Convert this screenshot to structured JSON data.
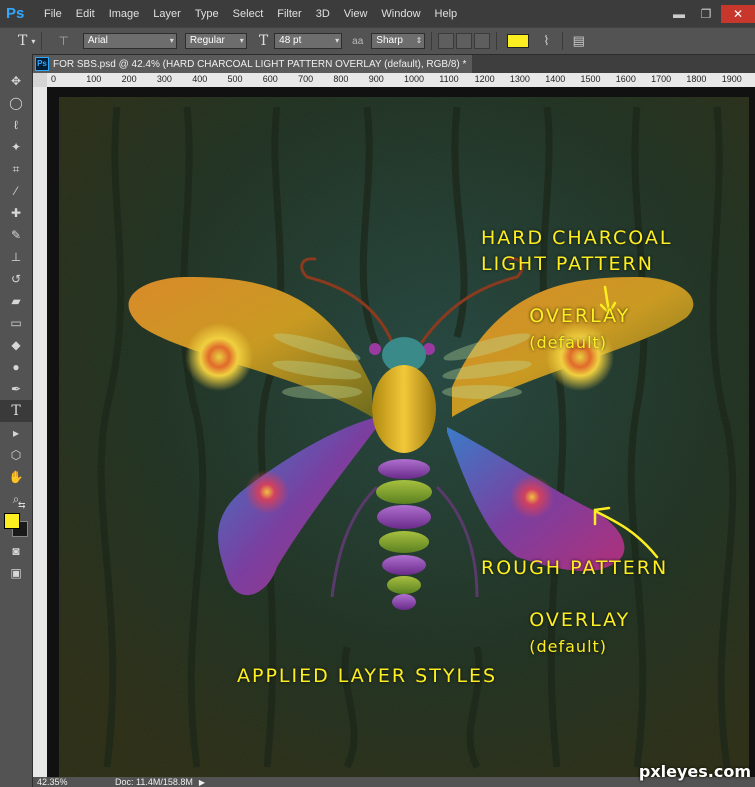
{
  "app": {
    "logo": "Ps"
  },
  "menu": [
    "File",
    "Edit",
    "Image",
    "Layer",
    "Type",
    "Select",
    "Filter",
    "3D",
    "View",
    "Window",
    "Help"
  ],
  "window_controls": {
    "minimize": "▬",
    "restore": "❐",
    "close": "✕"
  },
  "options": {
    "tool_icon": "T",
    "orientation_icon": "⊤",
    "font_family": "Arial",
    "font_style": "Regular",
    "size_icon": "T",
    "font_size": "48 pt",
    "aa_icon": "aa",
    "antialias": "Sharp",
    "warp_icon": "⌇",
    "panels_icon": "▤",
    "text_color": "#fcee21"
  },
  "document": {
    "tab_icon": "Ps",
    "tab_title": "FOR SBS.psd @ 42.4% (HARD CHARCOAL LIGHT PATTERN OVERLAY (default), RGB/8) *",
    "ruler_ticks": [
      "0",
      "100",
      "200",
      "300",
      "400",
      "500",
      "600",
      "700",
      "800",
      "900",
      "1000",
      "1100",
      "1200",
      "1300",
      "1400",
      "1500",
      "1600",
      "1700",
      "1800",
      "1900"
    ]
  },
  "tools": [
    {
      "name": "move",
      "glyph": "✥"
    },
    {
      "name": "marquee",
      "glyph": "◯"
    },
    {
      "name": "lasso",
      "glyph": "ℓ"
    },
    {
      "name": "quick-select",
      "glyph": "✦"
    },
    {
      "name": "crop",
      "glyph": "⌗"
    },
    {
      "name": "eyedropper",
      "glyph": "⁄"
    },
    {
      "name": "healing",
      "glyph": "✚"
    },
    {
      "name": "brush",
      "glyph": "✎"
    },
    {
      "name": "stamp",
      "glyph": "⊥"
    },
    {
      "name": "history-brush",
      "glyph": "↺"
    },
    {
      "name": "eraser",
      "glyph": "▰"
    },
    {
      "name": "gradient",
      "glyph": "▭"
    },
    {
      "name": "blur",
      "glyph": "◆"
    },
    {
      "name": "dodge",
      "glyph": "●"
    },
    {
      "name": "pen",
      "glyph": "✒"
    },
    {
      "name": "type",
      "glyph": "T"
    },
    {
      "name": "path-select",
      "glyph": "▸"
    },
    {
      "name": "shape",
      "glyph": "⬡"
    },
    {
      "name": "hand",
      "glyph": "✋"
    },
    {
      "name": "zoom",
      "glyph": "⌕"
    }
  ],
  "toolbox_extra": {
    "swap_icon": "⇆",
    "mask_icon": "◙",
    "screen_mode_icon": "▣"
  },
  "annotations": {
    "top_line1": "HARD CHARCOAL",
    "top_line2": "LIGHT PATTERN",
    "top_line3": "OVERLAY",
    "top_default": "(default)",
    "bottom_line1": "ROUGH PATTERN",
    "bottom_line2": "OVERLAY",
    "bottom_default": "(default)",
    "caption": "APPLIED LAYER STYLES"
  },
  "status": {
    "zoom": "42.35%",
    "doc": "Doc: 11.4M/158.8M",
    "arrow": "▶"
  },
  "watermark": "pxleyes.com"
}
